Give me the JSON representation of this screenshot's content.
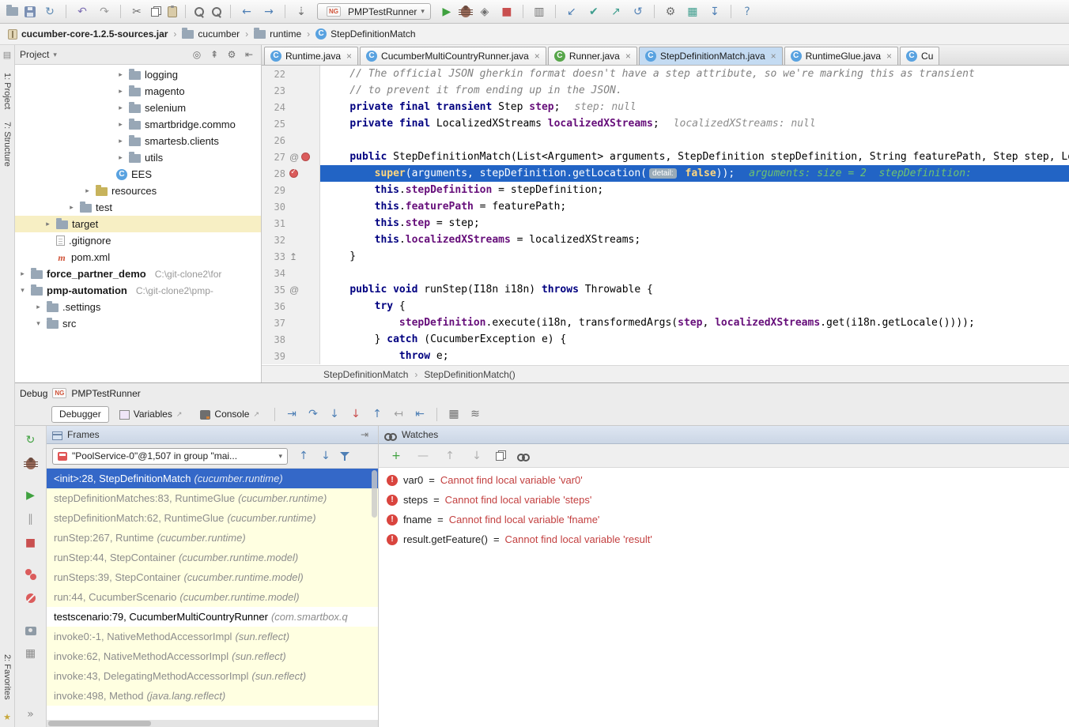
{
  "toolbar": {
    "run_config_label": "PMPTestRunner",
    "items": [
      {
        "name": "open-icon",
        "css": "folder"
      },
      {
        "name": "save-icon",
        "css": "floppy"
      },
      {
        "name": "sync-icon",
        "glyph": "↻",
        "color": "#5E8AB4"
      },
      {
        "sep": true
      },
      {
        "name": "undo-icon",
        "glyph": "↶",
        "color": "#7E6FB3"
      },
      {
        "name": "redo-icon",
        "glyph": "↷",
        "color": "#9A9A9A"
      },
      {
        "sep": true
      },
      {
        "name": "cut-icon",
        "glyph": "✂",
        "color": "#6E6E6E"
      },
      {
        "name": "copy-icon",
        "css": "copy"
      },
      {
        "name": "paste-icon",
        "css": "clipboard"
      },
      {
        "sep": true
      },
      {
        "name": "find-icon",
        "css": "magnifier"
      },
      {
        "name": "replace-icon",
        "css": "magnifier"
      },
      {
        "sep": true
      },
      {
        "name": "back-icon",
        "glyph": "←",
        "color": "#4E7FB5"
      },
      {
        "name": "forward-icon",
        "glyph": "→",
        "color": "#4E7FB5"
      },
      {
        "sep": true
      },
      {
        "name": "navigate-down-icon",
        "glyph": "⇣",
        "color": "#6E6E6E"
      },
      {
        "config": true
      },
      {
        "name": "run-icon",
        "glyph": "▶",
        "color": "#3FA13F"
      },
      {
        "name": "debug-icon",
        "css": "bug"
      },
      {
        "name": "coverage-icon",
        "glyph": "◈",
        "color": "#6E6E6E"
      },
      {
        "name": "stop-icon",
        "glyph": "■",
        "color": "#C94F4F"
      },
      {
        "sep": true
      },
      {
        "name": "tool-windows-icon",
        "glyph": "▥",
        "color": "#6E6E6E"
      },
      {
        "sep": true
      },
      {
        "name": "vcs-update-icon",
        "glyph": "↙",
        "color": "#4E7FB5"
      },
      {
        "name": "vcs-commit-icon",
        "glyph": "✔",
        "color": "#3F9E8E"
      },
      {
        "name": "vcs-push-icon",
        "glyph": "↗",
        "color": "#3F9E8E"
      },
      {
        "name": "vcs-rollback-icon",
        "glyph": "↺",
        "color": "#4E7FB5"
      },
      {
        "sep": true
      },
      {
        "name": "settings-icon",
        "glyph": "⚙",
        "color": "#6E6E6E"
      },
      {
        "name": "database-icon",
        "glyph": "▦",
        "color": "#3F9E8E"
      },
      {
        "name": "download-icon",
        "glyph": "↧",
        "color": "#4E7FB5"
      },
      {
        "sep": true
      },
      {
        "name": "help-icon",
        "glyph": "?",
        "color": "#5E8AB4"
      }
    ]
  },
  "breadcrumbs": {
    "items": [
      {
        "label": "cucumber-core-1.2.5-sources.jar",
        "icon": "jar",
        "bold": true
      },
      {
        "label": "cucumber",
        "icon": "folder"
      },
      {
        "label": "runtime",
        "icon": "folder"
      },
      {
        "label": "StepDefinitionMatch",
        "icon": "class"
      }
    ]
  },
  "left_stripe": {
    "project": "1: Project",
    "structure": "7: Structure",
    "favorites": "2: Favorites"
  },
  "project": {
    "title": "Project",
    "header_icons": [
      {
        "name": "locate-icon",
        "glyph": "◎",
        "color": "#6E6E6E"
      },
      {
        "name": "collapse-all-icon",
        "glyph": "⇞",
        "color": "#6E6E6E"
      },
      {
        "name": "settings-icon",
        "glyph": "⚙",
        "color": "#6E6E6E"
      },
      {
        "name": "hide-panel-icon",
        "glyph": "⇤",
        "color": "#6E6E6E"
      }
    ],
    "tree": [
      {
        "label": "logging",
        "icon": "folder",
        "arrow": "▸",
        "indent": 128
      },
      {
        "label": "magento",
        "icon": "folder",
        "arrow": "▸",
        "indent": 128
      },
      {
        "label": "selenium",
        "icon": "folder",
        "arrow": "▸",
        "indent": 128
      },
      {
        "label": "smartbridge.commo",
        "icon": "folder",
        "arrow": "▸",
        "indent": 128
      },
      {
        "label": "smartesb.clients",
        "icon": "folder",
        "arrow": "▸",
        "indent": 128
      },
      {
        "label": "utils",
        "icon": "folder",
        "arrow": "▸",
        "indent": 128
      },
      {
        "label": "EES",
        "icon": "class",
        "indent": 128,
        "noslot": true
      },
      {
        "label": "resources",
        "icon": "folder-res",
        "arrow": "▸",
        "indent": 86
      },
      {
        "label": "test",
        "icon": "folder",
        "arrow": "▸",
        "indent": 66
      },
      {
        "label": "target",
        "icon": "folder",
        "arrow": "▸",
        "indent": 36,
        "selected": true
      },
      {
        "label": ".gitignore",
        "icon": "file",
        "arrow": "",
        "indent": 36
      },
      {
        "label": "pom.xml",
        "icon": "maven",
        "arrow": "",
        "indent": 36
      },
      {
        "label": "force_partner_demo",
        "path": "C:\\git-clone2\\for",
        "icon": "folder",
        "arrow": "▸",
        "indent": 4,
        "bold": true
      },
      {
        "label": "pmp-automation",
        "path": "C:\\git-clone2\\pmp-",
        "icon": "folder",
        "arrow": "▾",
        "indent": 4,
        "bold": true
      },
      {
        "label": ".settings",
        "icon": "folder",
        "arrow": "▸",
        "indent": 24
      },
      {
        "label": "src",
        "icon": "folder",
        "arrow": "▾",
        "indent": 24
      }
    ]
  },
  "editor": {
    "tabs": [
      {
        "label": "Runtime.java",
        "color": "#59A2E0"
      },
      {
        "label": "CucumberMultiCountryRunner.java",
        "color": "#59A2E0"
      },
      {
        "label": "Runner.java",
        "color": "#57A64A"
      },
      {
        "label": "StepDefinitionMatch.java",
        "color": "#59A2E0",
        "active": true
      },
      {
        "label": "RuntimeGlue.java",
        "color": "#59A2E0"
      },
      {
        "label": "Cu",
        "color": "#59A2E0",
        "partial": true
      }
    ],
    "breadcrumb": [
      "StepDefinitionMatch",
      "StepDefinitionMatch()"
    ],
    "lines": [
      {
        "n": 22,
        "t": [
          [
            "c",
            "    // The official JSON gherkin format doesn't have a step attribute, so we're marking this as transient"
          ]
        ]
      },
      {
        "n": 23,
        "t": [
          [
            "c",
            "    // to prevent it from ending up in the JSON."
          ]
        ]
      },
      {
        "n": 24,
        "t": [
          [
            "p",
            "    "
          ],
          [
            "k",
            "private final transient "
          ],
          [
            "p",
            "Step "
          ],
          [
            "f",
            "step"
          ],
          [
            "p",
            ";"
          ]
        ],
        "hint": "step: null"
      },
      {
        "n": 25,
        "t": [
          [
            "p",
            "    "
          ],
          [
            "k",
            "private final "
          ],
          [
            "p",
            "LocalizedXStreams "
          ],
          [
            "f",
            "localizedXStreams"
          ],
          [
            "p",
            ";"
          ]
        ],
        "hint": "localizedXStreams: null"
      },
      {
        "n": 26,
        "t": []
      },
      {
        "n": 27,
        "g": [
          "at",
          "bp"
        ],
        "t": [
          [
            "p",
            "    "
          ],
          [
            "k",
            "public "
          ],
          [
            "p",
            "StepDefinitionMatch(List<Argument> arguments, StepDefinition stepDefinition, String featurePath, Step step, LocalizedXStreams localizedXStreams) {"
          ]
        ]
      },
      {
        "n": 28,
        "exec": true,
        "g": [
          "bpc"
        ],
        "t": [
          [
            "px",
            "        "
          ],
          [
            "kx",
            "super"
          ],
          [
            "px",
            "(arguments, stepDefinition.getLocation("
          ],
          [
            "pill",
            "detail:"
          ],
          [
            "px",
            " "
          ],
          [
            "kx",
            "false"
          ],
          [
            "px",
            "));"
          ]
        ],
        "hintg": "arguments: size = 2  stepDefinition:"
      },
      {
        "n": 29,
        "t": [
          [
            "p",
            "        "
          ],
          [
            "k",
            "this"
          ],
          [
            "p",
            "."
          ],
          [
            "f",
            "stepDefinition"
          ],
          [
            "p",
            " = stepDefinition;"
          ]
        ]
      },
      {
        "n": 30,
        "t": [
          [
            "p",
            "        "
          ],
          [
            "k",
            "this"
          ],
          [
            "p",
            "."
          ],
          [
            "f",
            "featurePath"
          ],
          [
            "p",
            " = featurePath;"
          ]
        ]
      },
      {
        "n": 31,
        "t": [
          [
            "p",
            "        "
          ],
          [
            "k",
            "this"
          ],
          [
            "p",
            "."
          ],
          [
            "f",
            "step"
          ],
          [
            "p",
            " = step;"
          ]
        ]
      },
      {
        "n": 32,
        "t": [
          [
            "p",
            "        "
          ],
          [
            "k",
            "this"
          ],
          [
            "p",
            "."
          ],
          [
            "f",
            "localizedXStreams"
          ],
          [
            "p",
            " = localizedXStreams;"
          ]
        ]
      },
      {
        "n": 33,
        "g": [
          "ret"
        ],
        "t": [
          [
            "p",
            "    }"
          ]
        ]
      },
      {
        "n": 34,
        "t": []
      },
      {
        "n": 35,
        "g": [
          "at"
        ],
        "t": [
          [
            "p",
            "    "
          ],
          [
            "k",
            "public void "
          ],
          [
            "p",
            "runStep(I18n i18n) "
          ],
          [
            "k",
            "throws"
          ],
          [
            "p",
            " Throwable {"
          ]
        ]
      },
      {
        "n": 36,
        "t": [
          [
            "p",
            "        "
          ],
          [
            "k",
            "try"
          ],
          [
            "p",
            " {"
          ]
        ]
      },
      {
        "n": 37,
        "t": [
          [
            "p",
            "            "
          ],
          [
            "f",
            "stepDefinition"
          ],
          [
            "p",
            ".execute(i18n, transformedArgs("
          ],
          [
            "f",
            "step"
          ],
          [
            "p",
            ", "
          ],
          [
            "f",
            "localizedXStreams"
          ],
          [
            "p",
            ".get(i18n.getLocale())));"
          ]
        ]
      },
      {
        "n": 38,
        "t": [
          [
            "p",
            "        } "
          ],
          [
            "k",
            "catch"
          ],
          [
            "p",
            " (CucumberException e) {"
          ]
        ]
      },
      {
        "n": 39,
        "t": [
          [
            "p",
            "            "
          ],
          [
            "k",
            "throw"
          ],
          [
            "p",
            " e;"
          ]
        ]
      }
    ]
  },
  "debug": {
    "window_title": "Debug",
    "config_label": "PMPTestRunner",
    "tabs": [
      {
        "label": "Debugger",
        "active": true
      },
      {
        "label": "Variables",
        "icon": "varic",
        "pin": "↗"
      },
      {
        "label": "Console",
        "icon": "consoleic",
        "pin": "↗"
      }
    ],
    "step_icons": [
      {
        "name": "show-execution-point-icon",
        "glyph": "⇥",
        "color": "#4E7FB5"
      },
      {
        "name": "step-over-icon",
        "glyph": "↷",
        "color": "#4E7FB5"
      },
      {
        "name": "step-into-icon",
        "glyph": "↓",
        "color": "#4E7FB5"
      },
      {
        "name": "force-step-into-icon",
        "glyph": "↓",
        "color": "#C94F4F"
      },
      {
        "name": "step-out-icon",
        "glyph": "↑",
        "color": "#4E7FB5"
      },
      {
        "name": "drop-frame-icon",
        "glyph": "↤",
        "color": "#9E9E9E"
      },
      {
        "name": "run-to-cursor-icon",
        "glyph": "⇤",
        "color": "#4E7FB5"
      },
      {
        "sep": true
      },
      {
        "name": "evaluate-expression-icon",
        "glyph": "▦",
        "color": "#6E6E6E"
      },
      {
        "name": "trace-settings-icon",
        "glyph": "≋",
        "color": "#6E6E6E"
      }
    ],
    "side_icons": [
      {
        "name": "rerun-icon",
        "glyph": "↻",
        "color": "#3FA13F"
      },
      {
        "name": "restart-debug-icon",
        "css": "bug"
      },
      {
        "name": "resume-icon",
        "glyph": "▶",
        "color": "#3FA13F",
        "gap": true
      },
      {
        "name": "pause-icon",
        "glyph": "∥",
        "color": "#9E9E9E"
      },
      {
        "name": "stop-debug-icon",
        "glyph": "■",
        "color": "#C94F4F"
      },
      {
        "name": "view-breakpoints-icon",
        "css": "bp2",
        "gap": true
      },
      {
        "name": "mute-breakpoints-icon",
        "css": "bpmute"
      },
      {
        "name": "thread-dump-icon",
        "css": "camera",
        "gap": true
      },
      {
        "name": "layout-settings-icon",
        "glyph": "▦",
        "color": "#8A8A8A"
      },
      {
        "name": "more-options-icon",
        "glyph": "»",
        "color": "#8A8A8A",
        "bottom": true
      }
    ],
    "frames": {
      "title": "Frames",
      "thread": "\"PoolService-0\"@1,507 in group \"mai...",
      "toolbar": [
        {
          "name": "prev-frame-icon",
          "glyph": "↑",
          "color": "#4E7FB5"
        },
        {
          "name": "next-frame-icon",
          "glyph": "↓",
          "color": "#4E7FB5"
        },
        {
          "name": "filter-frames-icon",
          "css": "funnel"
        }
      ],
      "items": [
        {
          "t": "<init>:28, StepDefinitionMatch",
          "p": "(cucumber.runtime)",
          "s": "sel"
        },
        {
          "t": "stepDefinitionMatches:83, RuntimeGlue",
          "p": "(cucumber.runtime)",
          "s": "lib"
        },
        {
          "t": "stepDefinitionMatch:62, RuntimeGlue",
          "p": "(cucumber.runtime)",
          "s": "lib"
        },
        {
          "t": "runStep:267, Runtime",
          "p": "(cucumber.runtime)",
          "s": "lib"
        },
        {
          "t": "runStep:44, StepContainer",
          "p": "(cucumber.runtime.model)",
          "s": "lib"
        },
        {
          "t": "runSteps:39, StepContainer",
          "p": "(cucumber.runtime.model)",
          "s": "lib"
        },
        {
          "t": "run:44, CucumberScenario",
          "p": "(cucumber.runtime.model)",
          "s": "lib"
        },
        {
          "t": "testscenario:79, CucumberMultiCountryRunner",
          "p": "(com.smartbox.q",
          "s": "proj"
        },
        {
          "t": "invoke0:-1, NativeMethodAccessorImpl",
          "p": "(sun.reflect)",
          "s": "lib"
        },
        {
          "t": "invoke:62, NativeMethodAccessorImpl",
          "p": "(sun.reflect)",
          "s": "lib"
        },
        {
          "t": "invoke:43, DelegatingMethodAccessorImpl",
          "p": "(sun.reflect)",
          "s": "lib"
        },
        {
          "t": "invoke:498, Method",
          "p": "(java.lang.reflect)",
          "s": "lib"
        }
      ]
    },
    "watches": {
      "title": "Watches",
      "toolbar": [
        {
          "name": "add-watch-icon",
          "glyph": "+",
          "color": "#3FA13F"
        },
        {
          "name": "remove-watch-icon",
          "glyph": "—",
          "color": "#B0B0B0"
        },
        {
          "name": "move-watch-up-icon",
          "glyph": "↑",
          "color": "#B0B0B0"
        },
        {
          "name": "move-watch-down-icon",
          "glyph": "↓",
          "color": "#B0B0B0"
        },
        {
          "name": "duplicate-watch-icon",
          "css": "copy"
        },
        {
          "name": "show-watches-icon",
          "css": "watchic"
        }
      ],
      "items": [
        {
          "name": "var0",
          "message": "Cannot find local variable 'var0'"
        },
        {
          "name": "steps",
          "message": "Cannot find local variable 'steps'"
        },
        {
          "name": "fname",
          "message": "Cannot find local variable 'fname'"
        },
        {
          "name": "result.getFeature()",
          "message": "Cannot find local variable 'result'"
        }
      ]
    }
  }
}
